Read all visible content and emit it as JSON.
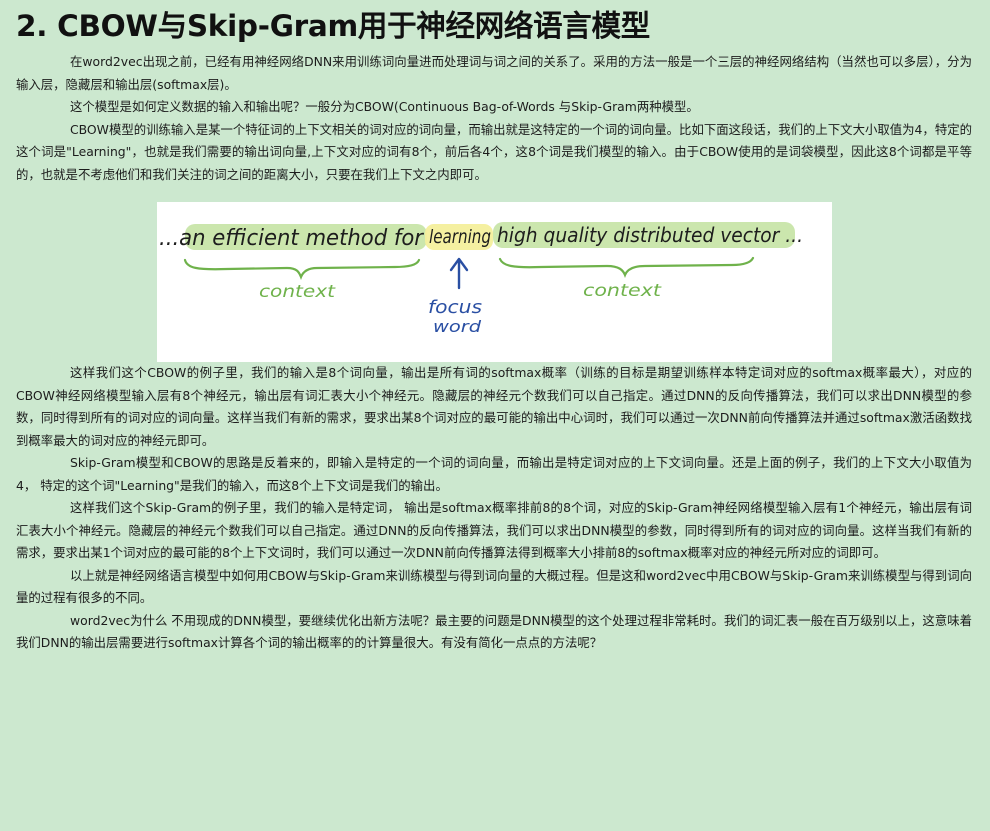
{
  "heading": "2. CBOW与Skip-Gram用于神经网络语言模型",
  "paragraphs": [
    "在word2vec出现之前，已经有用神经网络DNN来用训练词向量进而处理词与词之间的关系了。采用的方法一般是一个三层的神经网络结构（当然也可以多层），分为输入层，隐藏层和输出层(softmax层)。",
    "这个模型是如何定义数据的输入和输出呢？一般分为CBOW(Continuous Bag-of-Words 与Skip-Gram两种模型。",
    "CBOW模型的训练输入是某一个特征词的上下文相关的词对应的词向量，而输出就是这特定的一个词的词向量。比如下面这段话，我们的上下文大小取值为4，特定的这个词是\"Learning\"，也就是我们需要的输出词向量,上下文对应的词有8个，前后各4个，这8个词是我们模型的输入。由于CBOW使用的是词袋模型，因此这8个词都是平等的，也就是不考虑他们和我们关注的词之间的距离大小，只要在我们上下文之内即可。",
    "这样我们这个CBOW的例子里，我们的输入是8个词向量，输出是所有词的softmax概率（训练的目标是期望训练样本特定词对应的softmax概率最大），对应的CBOW神经网络模型输入层有8个神经元，输出层有词汇表大小个神经元。隐藏层的神经元个数我们可以自己指定。通过DNN的反向传播算法，我们可以求出DNN模型的参数，同时得到所有的词对应的词向量。这样当我们有新的需求，要求出某8个词对应的最可能的输出中心词时，我们可以通过一次DNN前向传播算法并通过softmax激活函数找到概率最大的词对应的神经元即可。",
    "Skip-Gram模型和CBOW的思路是反着来的，即输入是特定的一个词的词向量，而输出是特定词对应的上下文词向量。还是上面的例子，我们的上下文大小取值为4， 特定的这个词\"Learning\"是我们的输入，而这8个上下文词是我们的输出。",
    "这样我们这个Skip-Gram的例子里，我们的输入是特定词， 输出是softmax概率排前8的8个词，对应的Skip-Gram神经网络模型输入层有1个神经元，输出层有词汇表大小个神经元。隐藏层的神经元个数我们可以自己指定。通过DNN的反向传播算法，我们可以求出DNN模型的参数，同时得到所有的词对应的词向量。这样当我们有新的需求，要求出某1个词对应的最可能的8个上下文词时，我们可以通过一次DNN前向传播算法得到概率大小排前8的softmax概率对应的神经元所对应的词即可。",
    "以上就是神经网络语言模型中如何用CBOW与Skip-Gram来训练模型与得到词向量的大概过程。但是这和word2vec中用CBOW与Skip-Gram来训练模型与得到词向量的过程有很多的不同。",
    "word2vec为什么 不用现成的DNN模型，要继续优化出新方法呢？最主要的问题是DNN模型的这个处理过程非常耗时。我们的词汇表一般在百万级别以上，这意味着我们DNN的输出层需要进行softmax计算各个词的输出概率的的计算量很大。有没有简化一点点的方法呢？"
  ],
  "figure": {
    "sentence_left": "...an efficient method for",
    "focus_word": "learning",
    "sentence_right": "high quality distributed vector ...",
    "context_left": "context",
    "context_right": "context",
    "focus_label_line1": "focus",
    "focus_label_line2": "word",
    "colors": {
      "ink": "#1d1d1d",
      "context_green": "#6fb24b",
      "highlight_green": "#b9dd92",
      "highlight_yellow": "#f4ef9c",
      "arrow_blue": "#2a4fa3"
    }
  }
}
